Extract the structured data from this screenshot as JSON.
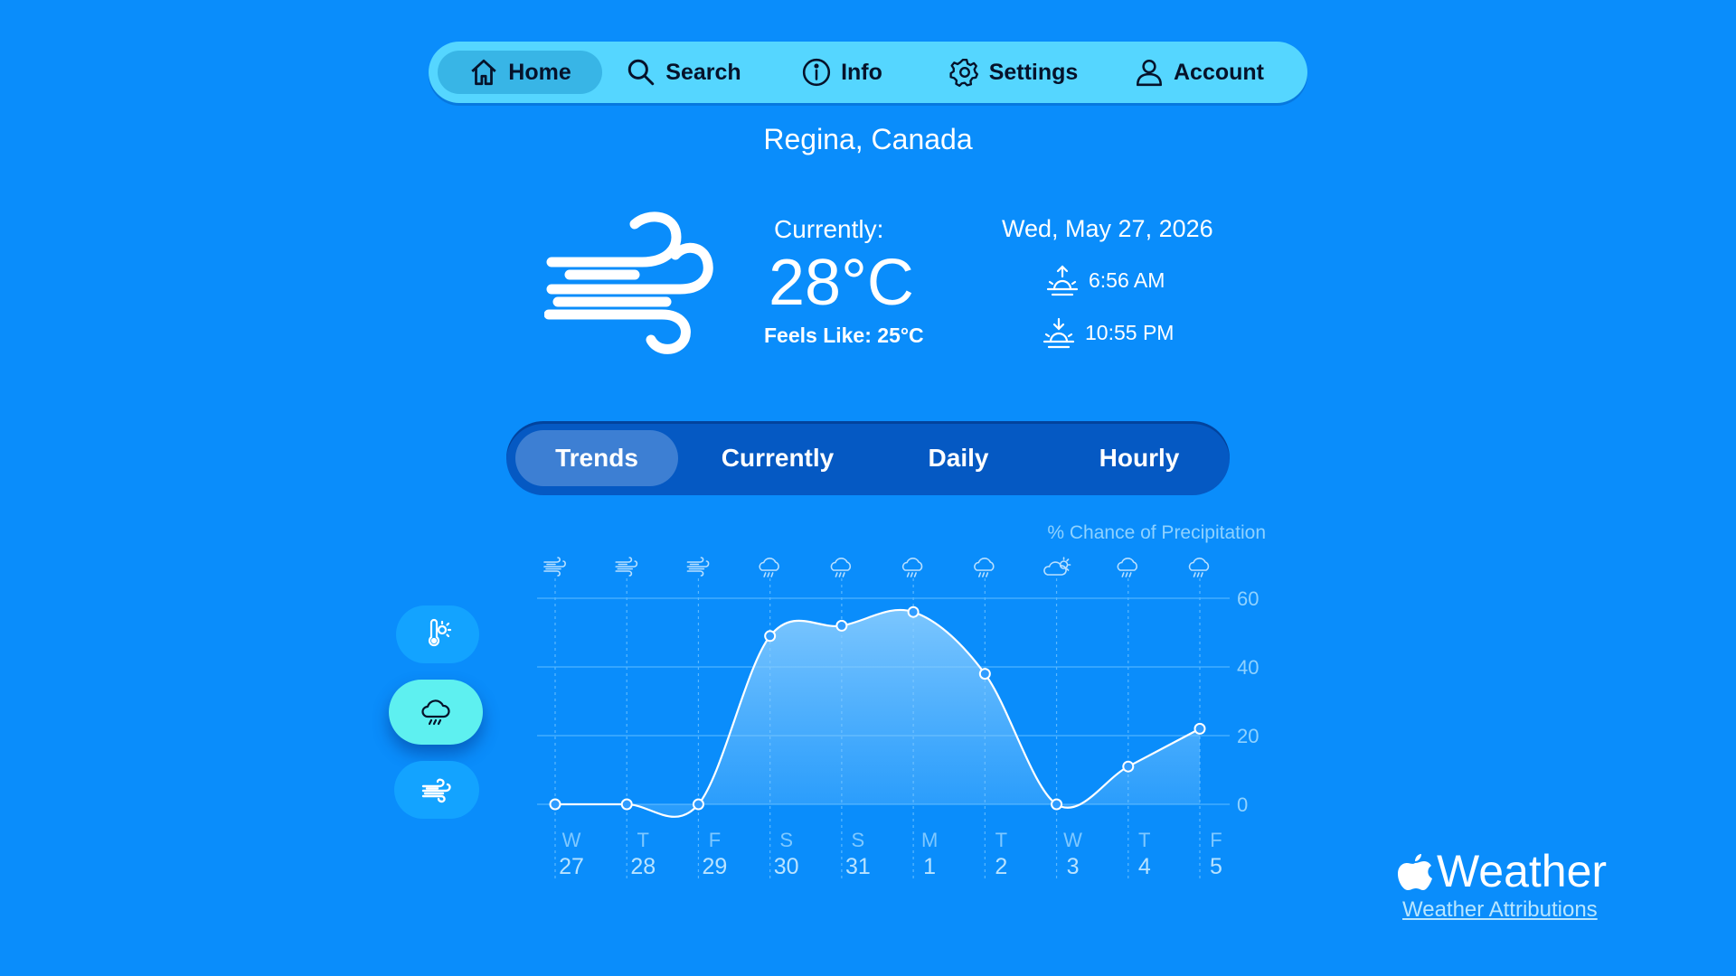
{
  "nav": {
    "items": [
      {
        "label": "Home",
        "icon": "home-icon",
        "active": true
      },
      {
        "label": "Search",
        "icon": "search-icon",
        "active": false
      },
      {
        "label": "Info",
        "icon": "info-icon",
        "active": false
      },
      {
        "label": "Settings",
        "icon": "gear-icon",
        "active": false
      },
      {
        "label": "Account",
        "icon": "account-icon",
        "active": false
      }
    ]
  },
  "location": "Regina, Canada",
  "current": {
    "icon": "wind-icon",
    "label": "Currently:",
    "temperature": "28°C",
    "feels_like": "Feels Like: 25°C"
  },
  "date": "Wed, May 27, 2026",
  "sunrise": "6:56 AM",
  "sunset": "10:55 PM",
  "tabs": [
    {
      "label": "Trends",
      "active": true
    },
    {
      "label": "Currently",
      "active": false
    },
    {
      "label": "Daily",
      "active": false
    },
    {
      "label": "Hourly",
      "active": false
    }
  ],
  "side_buttons": [
    {
      "icon": "temperature-sun-icon",
      "active": false
    },
    {
      "icon": "rain-cloud-icon",
      "active": true
    },
    {
      "icon": "wind-icon",
      "active": false
    }
  ],
  "colors": {
    "background": "#0a8dfb",
    "nav": "#55d6ff",
    "segment": "#0559c3",
    "active_side": "#5ef0f0"
  },
  "chart_data": {
    "type": "area",
    "title": "% Chance of Precipitation",
    "ylim": [
      0,
      60
    ],
    "yticks": [
      0,
      20,
      40,
      60
    ],
    "categories": [
      {
        "day": "W",
        "date": "27",
        "icon": "wind-icon"
      },
      {
        "day": "T",
        "date": "28",
        "icon": "wind-icon"
      },
      {
        "day": "F",
        "date": "29",
        "icon": "wind-icon"
      },
      {
        "day": "S",
        "date": "30",
        "icon": "rain-cloud-icon"
      },
      {
        "day": "S",
        "date": "31",
        "icon": "rain-cloud-icon"
      },
      {
        "day": "M",
        "date": "1",
        "icon": "rain-cloud-icon"
      },
      {
        "day": "T",
        "date": "2",
        "icon": "rain-cloud-icon"
      },
      {
        "day": "W",
        "date": "3",
        "icon": "partly-sunny-icon"
      },
      {
        "day": "T",
        "date": "4",
        "icon": "rain-cloud-icon"
      },
      {
        "day": "F",
        "date": "5",
        "icon": "rain-cloud-icon"
      }
    ],
    "values": [
      0,
      0,
      0,
      49,
      52,
      56,
      38,
      0,
      11,
      22
    ],
    "grid": true
  },
  "brand": {
    "name": "Weather",
    "attribution": "Weather Attributions"
  }
}
